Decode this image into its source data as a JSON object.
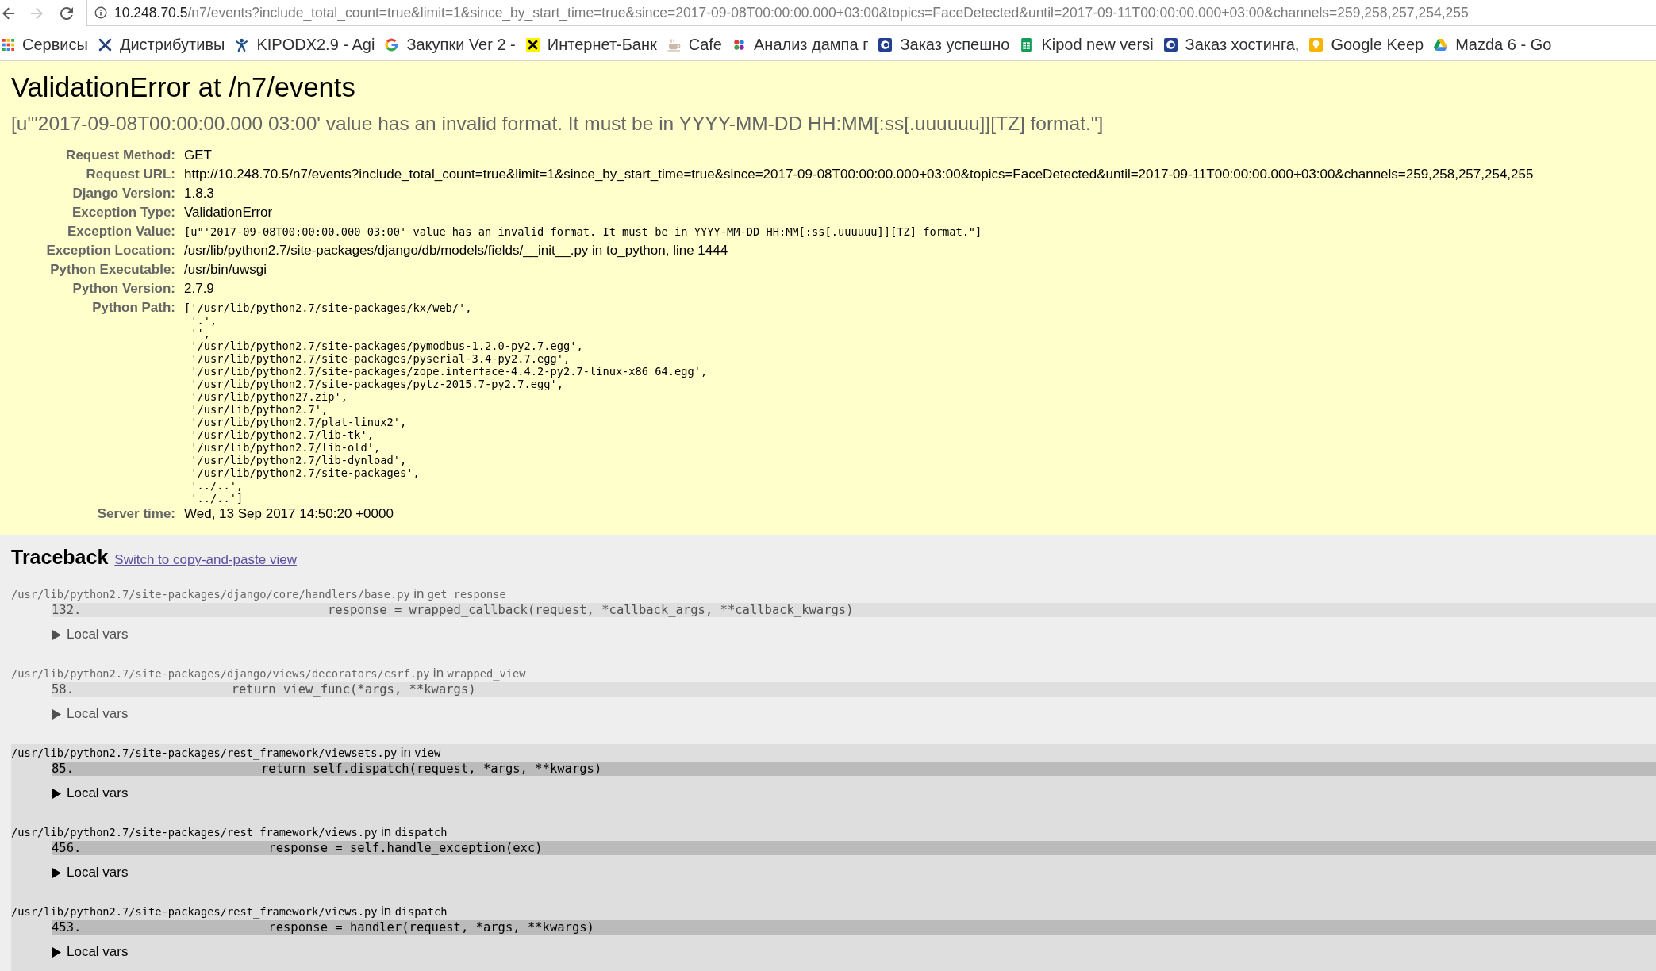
{
  "browser": {
    "nav_buttons": [
      {
        "kind": "back",
        "disabled": false
      },
      {
        "kind": "forward",
        "disabled": true
      },
      {
        "kind": "reload",
        "disabled": false
      }
    ],
    "address": {
      "host": "10.248.70.5",
      "path": "/n7/events?include_total_count=true&limit=1&since_by_start_time=true&since=2017-09-08T00:00:00.000+03:00&topics=FaceDetected&until=2017-09-11T00:00:00.000+03:00&channels=259,258,257,254,255"
    },
    "bookmarks": [
      "Сервисы",
      "Дистрибутивы",
      "KIPODX2.9 - Agi",
      "Закупки Ver 2 -",
      "Интернет-Банк",
      "Cafe",
      "Анализ дампа г",
      "Заказ успешно",
      "Kipod new versi",
      "Заказ хостинга,",
      "Google Keep",
      "Mazda 6 - Go"
    ]
  },
  "summary": {
    "title": "ValidationError at /n7/events",
    "message": "[u\"'2017-09-08T00:00:00.000 03:00' value has an invalid format. It must be in YYYY-MM-DD HH:MM[:ss[.uuuuuu]][TZ] format.\"]",
    "meta": [
      {
        "kind": "text",
        "label": "Request Method:",
        "value": "GET"
      },
      {
        "kind": "text",
        "label": "Request URL:",
        "value": "http://10.248.70.5/n7/events?include_total_count=true&limit=1&since_by_start_time=true&since=2017-09-08T00:00:00.000+03:00&topics=FaceDetected&until=2017-09-11T00:00:00.000+03:00&channels=259,258,257,254,255"
      },
      {
        "kind": "text",
        "label": "Django Version:",
        "value": "1.8.3"
      },
      {
        "kind": "text",
        "label": "Exception Type:",
        "value": "ValidationError"
      },
      {
        "kind": "code",
        "label": "Exception Value:",
        "value": "[u\"'2017-09-08T00:00:00.000 03:00' value has an invalid format. It must be in YYYY-MM-DD HH:MM[:ss[.uuuuuu]][TZ] format.\"]"
      },
      {
        "kind": "text",
        "label": "Exception Location:",
        "value": "/usr/lib/python2.7/site-packages/django/db/models/fields/__init__.py in to_python, line 1444"
      },
      {
        "kind": "text",
        "label": "Python Executable:",
        "value": "/usr/bin/uwsgi"
      },
      {
        "kind": "text",
        "label": "Python Version:",
        "value": "2.7.9"
      },
      {
        "kind": "lines",
        "label": "Python Path:",
        "lines": [
          "['/usr/lib/python2.7/site-packages/kx/web/',",
          " '.',",
          " '',",
          " '/usr/lib/python2.7/site-packages/pymodbus-1.2.0-py2.7.egg',",
          " '/usr/lib/python2.7/site-packages/pyserial-3.4-py2.7.egg',",
          " '/usr/lib/python2.7/site-packages/zope.interface-4.4.2-py2.7-linux-x86_64.egg',",
          " '/usr/lib/python2.7/site-packages/pytz-2015.7-py2.7.egg',",
          " '/usr/lib/python27.zip',",
          " '/usr/lib/python2.7',",
          " '/usr/lib/python2.7/plat-linux2',",
          " '/usr/lib/python2.7/lib-tk',",
          " '/usr/lib/python2.7/lib-old',",
          " '/usr/lib/python2.7/lib-dynload',",
          " '/usr/lib/python2.7/site-packages',",
          " '../..',",
          " '../..']"
        ]
      },
      {
        "kind": "text",
        "label": "Server time:",
        "value": "Wed, 13 Sep 2017 14:50:20 +0000"
      }
    ]
  },
  "traceback": {
    "title": "Traceback",
    "link": "Switch to copy-and-paste view",
    "frames": [
      {
        "kind": "django",
        "file": "/usr/lib/python2.7/site-packages/django/core/handlers/base.py",
        "joiner": "in",
        "function": "get_response",
        "line_number": "132.",
        "code": "                    response = wrapped_callback(request, *callback_args, **callback_kwargs)",
        "locals_label": "Local vars",
        "expanded": false
      },
      {
        "kind": "django",
        "file": "/usr/lib/python2.7/site-packages/django/views/decorators/csrf.py",
        "joiner": "in",
        "function": "wrapped_view",
        "line_number": "58.",
        "code": "        return view_func(*args, **kwargs)",
        "locals_label": "Local vars",
        "expanded": false
      },
      {
        "kind": "user",
        "file": "/usr/lib/python2.7/site-packages/rest_framework/viewsets.py",
        "joiner": "in",
        "function": "view",
        "line_number": "85.",
        "code": "            return self.dispatch(request, *args, **kwargs)",
        "locals_label": "Local vars",
        "expanded": false
      },
      {
        "kind": "user",
        "file": "/usr/lib/python2.7/site-packages/rest_framework/views.py",
        "joiner": "in",
        "function": "dispatch",
        "line_number": "456.",
        "code": "            response = self.handle_exception(exc)",
        "locals_label": "Local vars",
        "expanded": false
      },
      {
        "kind": "user",
        "file": "/usr/lib/python2.7/site-packages/rest_framework/views.py",
        "joiner": "in",
        "function": "dispatch",
        "line_number": "453.",
        "code": "            response = handler(request, *args, **kwargs)",
        "locals_label": "Local vars",
        "expanded": false
      }
    ]
  }
}
